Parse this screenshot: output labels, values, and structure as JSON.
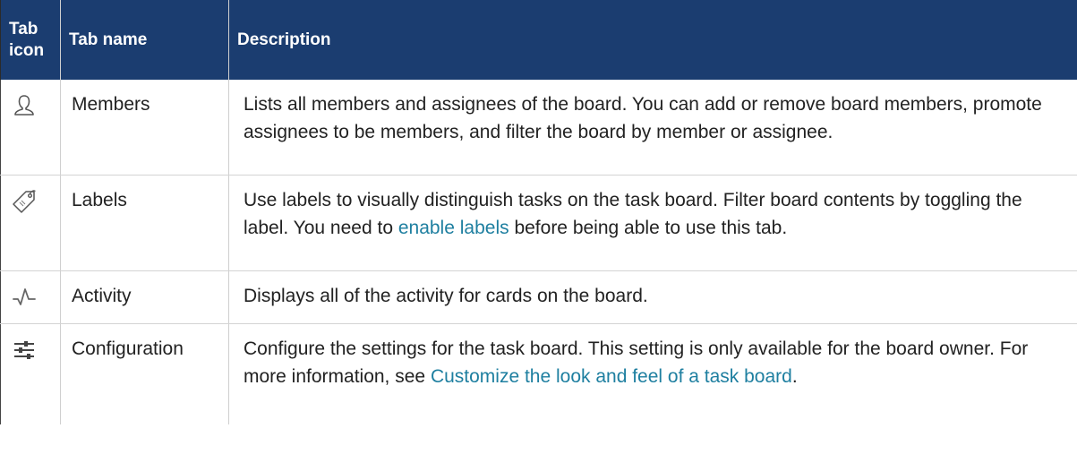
{
  "headers": {
    "icon_col": "Tab icon",
    "name_col": "Tab name",
    "desc_col": "Description"
  },
  "rows": [
    {
      "icon": "member-icon",
      "name": "Members",
      "description": "Lists all members and assignees of the board. You can add or remove board members, promote assignees to be members, and filter the board by member or assignee."
    },
    {
      "icon": "label-tag-icon",
      "name": "Labels",
      "description_before": "Use labels to visually distinguish tasks on the task board. Filter board contents by toggling the label. You need to ",
      "link": "enable labels",
      "description_after": " before being able to use this tab."
    },
    {
      "icon": "activity-icon",
      "name": "Activity",
      "description": "Displays all of the activity for cards on the board."
    },
    {
      "icon": "sliders-icon",
      "name": "Configuration",
      "description_before": "Configure the settings for the task board. This setting is only available for the board owner. For more information, see ",
      "link": "Customize the look and feel of a task board",
      "description_after": "."
    }
  ],
  "colors": {
    "header_bg": "#1b3d70",
    "header_text": "#ffffff",
    "link": "#1e7fa0",
    "body_text": "#222222"
  }
}
